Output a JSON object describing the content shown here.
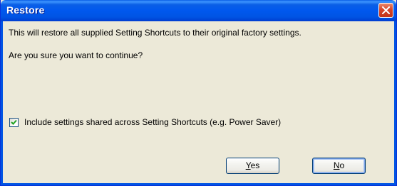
{
  "dialog": {
    "title": "Restore",
    "message": "This will restore all supplied Setting Shortcuts to their original factory settings.",
    "question": "Are you sure you want to continue?",
    "checkbox": {
      "label": "Include settings shared across Setting Shortcuts (e.g. Power Saver)",
      "checked": true
    },
    "buttons": {
      "yes_accel": "Y",
      "yes_rest": "es",
      "no_accel": "N",
      "no_rest": "o"
    },
    "icons": {
      "close": "close-icon",
      "check": "checkmark-icon"
    },
    "colors": {
      "titlebar": "#0054e3",
      "close_button": "#d6452a",
      "dialog_bg": "#ece9d8",
      "check_green": "#21a121"
    }
  }
}
